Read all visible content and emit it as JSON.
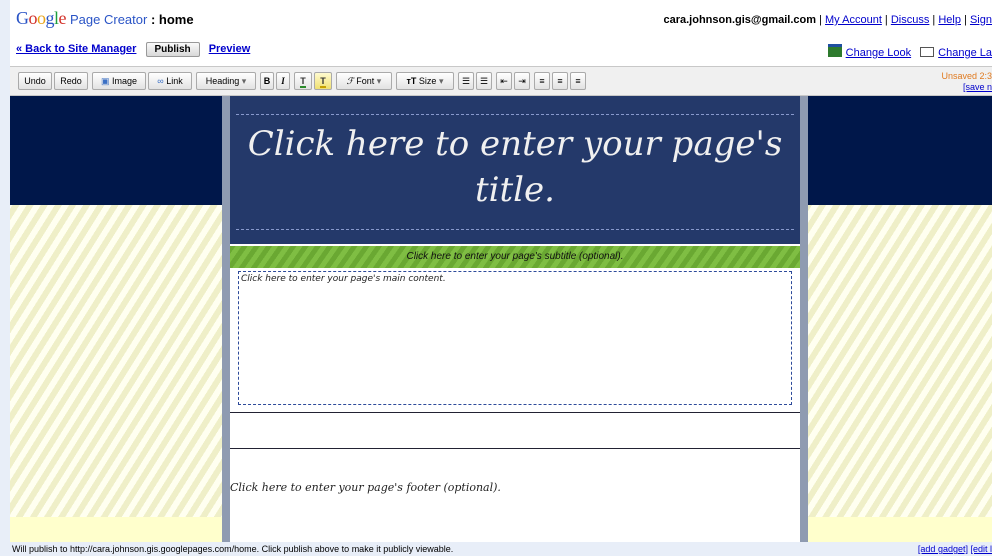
{
  "header": {
    "logo_letters": [
      "G",
      "o",
      "o",
      "g",
      "l",
      "e"
    ],
    "app_name": "Page Creator",
    "page_sep": " : ",
    "page_name": "home",
    "account_email": "cara.johnson.gis@gmail.com",
    "account_links": [
      "My Account",
      "Discuss",
      "Help",
      "Sign"
    ],
    "back_link": "« Back to Site Manager",
    "publish_label": "Publish",
    "preview_label": "Preview",
    "change_look_label": "Change Look",
    "change_layout_label": "Change La"
  },
  "toolbar": {
    "undo": "Undo",
    "redo": "Redo",
    "image": "Image",
    "link": "Link",
    "heading": "Heading",
    "bold": "B",
    "italic": "I",
    "font": "Font",
    "size": "Size",
    "unsaved_line1": "Unsaved 2:3",
    "unsaved_line2": "[save n"
  },
  "page": {
    "title_placeholder": "Click here to enter your page's title.",
    "subtitle_placeholder": "Click here to enter your page's subtitle (optional).",
    "content_placeholder": "Click here to enter your page's main content.",
    "footer_placeholder": "Click here to enter your page's footer (optional)."
  },
  "status": {
    "message": "Will publish to http://cara.johnson.gis.googlepages.com/home. Click publish above to make it publicly viewable.",
    "add_gadget": "[add gadget]",
    "edit": "[edit l"
  },
  "colors": {
    "navy_band": "#00174a",
    "title_bg": "#24396a",
    "subtitle_bg": "#7fbe43",
    "page_bg": "#ffffcc",
    "unsaved": "#e07a1f"
  }
}
